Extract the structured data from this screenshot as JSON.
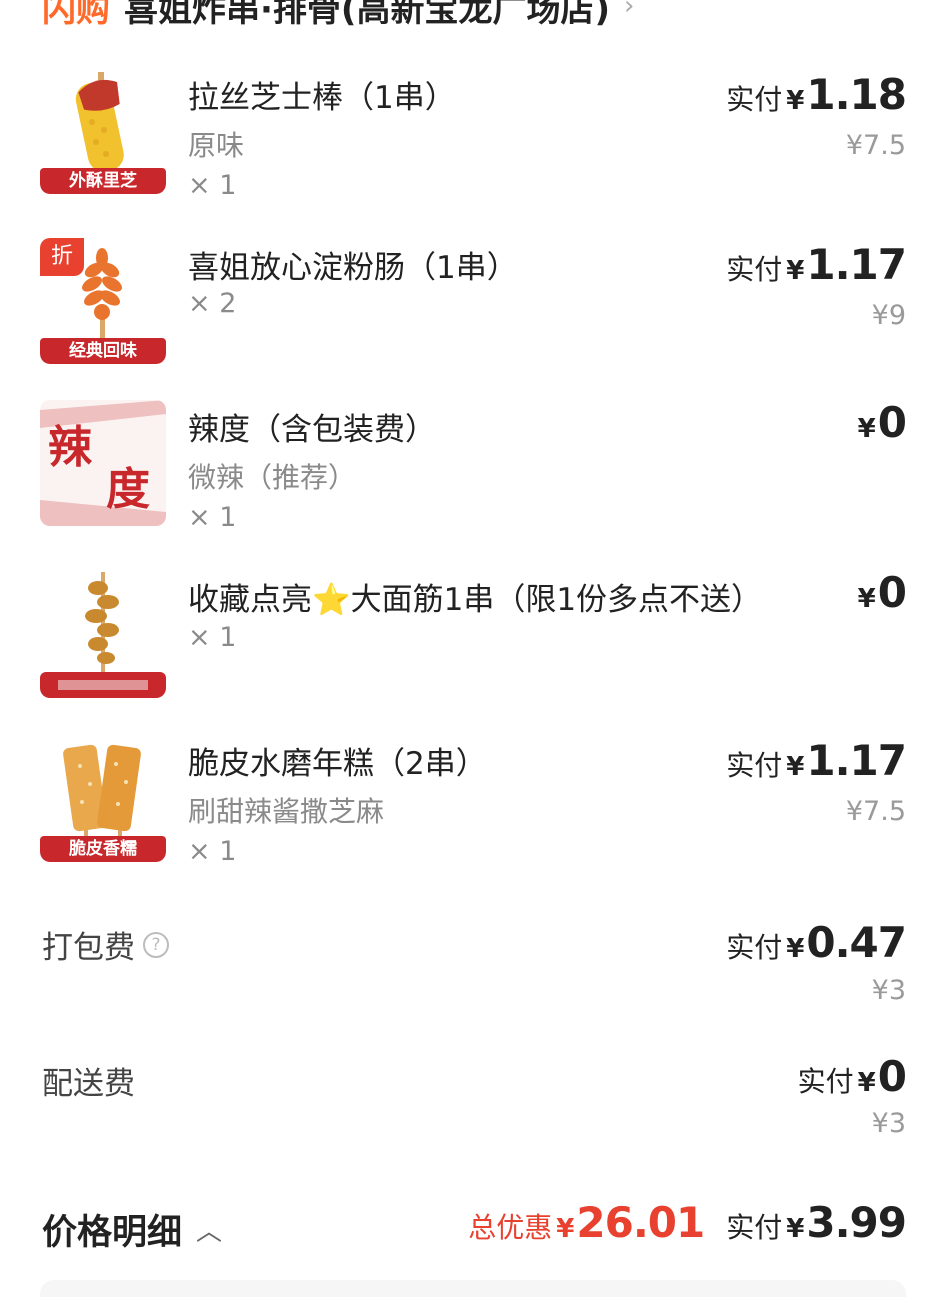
{
  "store": {
    "tag": "闪购",
    "name": "喜姐炸串·排骨(高新宝龙广场店)"
  },
  "items": [
    {
      "name": "拉丝芝士棒（1串）",
      "spec": "原味",
      "qty": "× 1",
      "pay_label": "实付",
      "currency": "¥",
      "pay": "1.18",
      "original": "¥7.5",
      "banner": "外酥里芝"
    },
    {
      "name": "喜姐放心淀粉肠（1串）",
      "qty": "× 2",
      "pay_label": "实付",
      "currency": "¥",
      "pay": "1.17",
      "original": "¥9",
      "banner": "经典回味",
      "discount_badge": "折"
    },
    {
      "name": "辣度（含包装费）",
      "spec": "微辣（推荐）",
      "qty": "× 1",
      "currency": "¥",
      "pay": "0",
      "thumb_text": [
        "辣",
        "度"
      ]
    },
    {
      "name": "收藏点亮⭐大面筋1串（限1份多点不送）",
      "qty": "× 1",
      "currency": "¥",
      "pay": "0"
    },
    {
      "name": "脆皮水磨年糕（2串）",
      "spec": "刷甜辣酱撒芝麻",
      "qty": "× 1",
      "pay_label": "实付",
      "currency": "¥",
      "pay": "1.17",
      "original": "¥7.5",
      "banner": "脆皮香糯"
    }
  ],
  "packing_fee": {
    "label": "打包费",
    "help_icon": "question-circle-icon",
    "pay_label": "实付",
    "currency": "¥",
    "pay": "0.47",
    "original": "¥3"
  },
  "delivery_fee": {
    "label": "配送费",
    "pay_label": "实付",
    "currency": "¥",
    "pay": "0",
    "original": "¥3"
  },
  "summary": {
    "title": "价格明细",
    "discount_label": "总优惠",
    "currency": "¥",
    "discount": "26.01",
    "total_label": "实付",
    "total": "3.99"
  },
  "colors": {
    "accent_red": "#e8412f",
    "banner_red": "#c8282c",
    "flash_orange": "#ff6a2a",
    "muted": "#8a8a8a"
  }
}
